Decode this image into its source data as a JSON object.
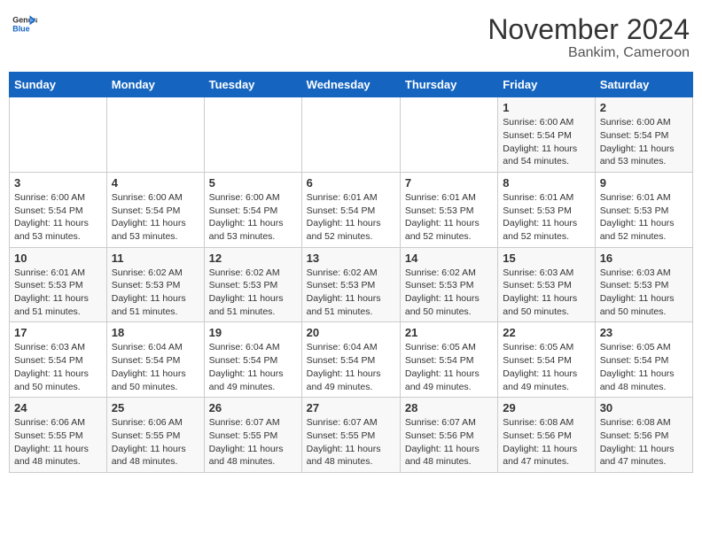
{
  "header": {
    "logo_general": "General",
    "logo_blue": "Blue",
    "month_year": "November 2024",
    "location": "Bankim, Cameroon"
  },
  "days_of_week": [
    "Sunday",
    "Monday",
    "Tuesday",
    "Wednesday",
    "Thursday",
    "Friday",
    "Saturday"
  ],
  "weeks": [
    [
      {
        "day": "",
        "info": ""
      },
      {
        "day": "",
        "info": ""
      },
      {
        "day": "",
        "info": ""
      },
      {
        "day": "",
        "info": ""
      },
      {
        "day": "",
        "info": ""
      },
      {
        "day": "1",
        "info": "Sunrise: 6:00 AM\nSunset: 5:54 PM\nDaylight: 11 hours\nand 54 minutes."
      },
      {
        "day": "2",
        "info": "Sunrise: 6:00 AM\nSunset: 5:54 PM\nDaylight: 11 hours\nand 53 minutes."
      }
    ],
    [
      {
        "day": "3",
        "info": "Sunrise: 6:00 AM\nSunset: 5:54 PM\nDaylight: 11 hours\nand 53 minutes."
      },
      {
        "day": "4",
        "info": "Sunrise: 6:00 AM\nSunset: 5:54 PM\nDaylight: 11 hours\nand 53 minutes."
      },
      {
        "day": "5",
        "info": "Sunrise: 6:00 AM\nSunset: 5:54 PM\nDaylight: 11 hours\nand 53 minutes."
      },
      {
        "day": "6",
        "info": "Sunrise: 6:01 AM\nSunset: 5:54 PM\nDaylight: 11 hours\nand 52 minutes."
      },
      {
        "day": "7",
        "info": "Sunrise: 6:01 AM\nSunset: 5:53 PM\nDaylight: 11 hours\nand 52 minutes."
      },
      {
        "day": "8",
        "info": "Sunrise: 6:01 AM\nSunset: 5:53 PM\nDaylight: 11 hours\nand 52 minutes."
      },
      {
        "day": "9",
        "info": "Sunrise: 6:01 AM\nSunset: 5:53 PM\nDaylight: 11 hours\nand 52 minutes."
      }
    ],
    [
      {
        "day": "10",
        "info": "Sunrise: 6:01 AM\nSunset: 5:53 PM\nDaylight: 11 hours\nand 51 minutes."
      },
      {
        "day": "11",
        "info": "Sunrise: 6:02 AM\nSunset: 5:53 PM\nDaylight: 11 hours\nand 51 minutes."
      },
      {
        "day": "12",
        "info": "Sunrise: 6:02 AM\nSunset: 5:53 PM\nDaylight: 11 hours\nand 51 minutes."
      },
      {
        "day": "13",
        "info": "Sunrise: 6:02 AM\nSunset: 5:53 PM\nDaylight: 11 hours\nand 51 minutes."
      },
      {
        "day": "14",
        "info": "Sunrise: 6:02 AM\nSunset: 5:53 PM\nDaylight: 11 hours\nand 50 minutes."
      },
      {
        "day": "15",
        "info": "Sunrise: 6:03 AM\nSunset: 5:53 PM\nDaylight: 11 hours\nand 50 minutes."
      },
      {
        "day": "16",
        "info": "Sunrise: 6:03 AM\nSunset: 5:53 PM\nDaylight: 11 hours\nand 50 minutes."
      }
    ],
    [
      {
        "day": "17",
        "info": "Sunrise: 6:03 AM\nSunset: 5:54 PM\nDaylight: 11 hours\nand 50 minutes."
      },
      {
        "day": "18",
        "info": "Sunrise: 6:04 AM\nSunset: 5:54 PM\nDaylight: 11 hours\nand 50 minutes."
      },
      {
        "day": "19",
        "info": "Sunrise: 6:04 AM\nSunset: 5:54 PM\nDaylight: 11 hours\nand 49 minutes."
      },
      {
        "day": "20",
        "info": "Sunrise: 6:04 AM\nSunset: 5:54 PM\nDaylight: 11 hours\nand 49 minutes."
      },
      {
        "day": "21",
        "info": "Sunrise: 6:05 AM\nSunset: 5:54 PM\nDaylight: 11 hours\nand 49 minutes."
      },
      {
        "day": "22",
        "info": "Sunrise: 6:05 AM\nSunset: 5:54 PM\nDaylight: 11 hours\nand 49 minutes."
      },
      {
        "day": "23",
        "info": "Sunrise: 6:05 AM\nSunset: 5:54 PM\nDaylight: 11 hours\nand 48 minutes."
      }
    ],
    [
      {
        "day": "24",
        "info": "Sunrise: 6:06 AM\nSunset: 5:55 PM\nDaylight: 11 hours\nand 48 minutes."
      },
      {
        "day": "25",
        "info": "Sunrise: 6:06 AM\nSunset: 5:55 PM\nDaylight: 11 hours\nand 48 minutes."
      },
      {
        "day": "26",
        "info": "Sunrise: 6:07 AM\nSunset: 5:55 PM\nDaylight: 11 hours\nand 48 minutes."
      },
      {
        "day": "27",
        "info": "Sunrise: 6:07 AM\nSunset: 5:55 PM\nDaylight: 11 hours\nand 48 minutes."
      },
      {
        "day": "28",
        "info": "Sunrise: 6:07 AM\nSunset: 5:56 PM\nDaylight: 11 hours\nand 48 minutes."
      },
      {
        "day": "29",
        "info": "Sunrise: 6:08 AM\nSunset: 5:56 PM\nDaylight: 11 hours\nand 47 minutes."
      },
      {
        "day": "30",
        "info": "Sunrise: 6:08 AM\nSunset: 5:56 PM\nDaylight: 11 hours\nand 47 minutes."
      }
    ]
  ]
}
